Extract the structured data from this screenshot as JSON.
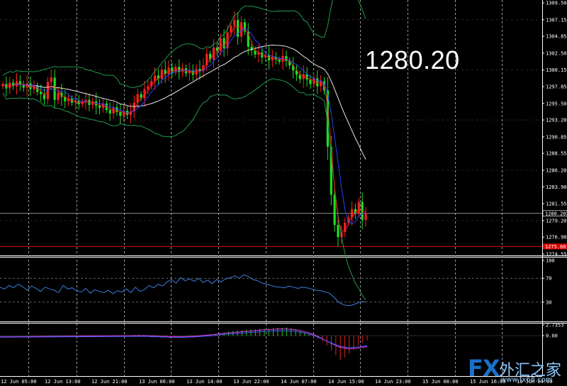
{
  "overlay_price": "1280.20",
  "logo": {
    "fx": "FX",
    "cn": "外汇之家",
    "url": "www.fx68.com"
  },
  "chart_data": [
    {
      "type": "candlestick",
      "panel": "main",
      "ylim": [
        1274.55,
        1309.5
      ],
      "y_ticks": [
        "1309.50",
        "1307.15",
        "1304.85",
        "1302.50",
        "1300.15",
        "1297.85",
        "1295.50",
        "1293.20",
        "1290.85",
        "1288.55",
        "1286.20",
        "1283.90",
        "1281.55",
        "1280.20",
        "1279.20",
        "1276.90",
        "1275.60",
        "1274.55"
      ],
      "current_price": 1280.2,
      "red_line_price": 1275.6,
      "x_labels": [
        "12 Jun 05:00",
        "12 Jun 13:00",
        "12 Jun 21:00",
        "13 Jun 06:00",
        "13 Jun 14:00",
        "13 Jun 22:00",
        "14 Jun 07:00",
        "14 Jun 15:00",
        "14 Jun 23:00",
        "15 Jun 08:00",
        "15 Jun 16:00",
        "18 Jun 04:00"
      ],
      "closes": [
        1298.2,
        1297.6,
        1298.4,
        1297.9,
        1298.6,
        1298.1,
        1297.7,
        1298.3,
        1297.5,
        1298.0,
        1297.1,
        1296.8,
        1296.1,
        1298.5,
        1299.1,
        1296.0,
        1297.0,
        1296.4,
        1295.8,
        1296.2,
        1295.6,
        1295.9,
        1295.4,
        1295.7,
        1296.0,
        1295.3,
        1295.8,
        1295.2,
        1294.9,
        1295.5,
        1294.6,
        1294.1,
        1295.0,
        1294.3,
        1293.8,
        1294.5,
        1293.9,
        1294.4,
        1295.6,
        1296.8,
        1296.2,
        1297.5,
        1297.9,
        1298.6,
        1299.4,
        1298.9,
        1300.2,
        1299.6,
        1300.5,
        1299.8,
        1300.6,
        1299.9,
        1300.4,
        1299.7,
        1300.1,
        1299.5,
        1300.3,
        1300.0,
        1300.8,
        1302.4,
        1301.6,
        1303.3,
        1302.8,
        1304.6,
        1303.2,
        1305.4,
        1306.3,
        1307.1,
        1304.8,
        1306.8,
        1305.5,
        1303.4,
        1302.9,
        1302.3,
        1302.6,
        1301.9,
        1302.2,
        1301.5,
        1302.0,
        1301.6,
        1301.3,
        1302.1,
        1301.4,
        1300.8,
        1300.1,
        1299.5,
        1298.9,
        1299.6,
        1298.8,
        1298.2,
        1299.0,
        1297.9,
        1298.6,
        1297.3,
        1289.5,
        1282.8,
        1278.6,
        1276.9,
        1277.6,
        1278.9,
        1279.6,
        1280.8,
        1280.2,
        1281.8,
        1279.3,
        1280.2
      ],
      "indicators": [
        "ma_white",
        "ma_blue",
        "ma_red",
        "bollinger_upper",
        "bollinger_lower"
      ]
    },
    {
      "type": "line",
      "panel": "rsi",
      "ylim": [
        0,
        100
      ],
      "y_ticks": [
        100,
        70,
        30,
        0
      ],
      "series": [
        {
          "values": [
            55,
            52,
            58,
            54,
            60,
            56,
            50,
            57,
            53,
            48,
            55,
            52,
            50,
            46,
            58,
            52,
            54,
            49,
            47,
            53,
            45,
            51,
            48,
            46,
            50,
            44,
            49,
            47,
            52,
            46,
            55,
            48,
            51,
            58,
            54,
            60,
            57,
            64,
            68,
            62,
            71,
            66,
            69,
            65,
            70,
            63,
            67,
            61,
            68,
            64,
            69,
            71,
            74,
            70,
            76,
            73,
            68,
            66,
            62,
            60,
            58,
            56,
            55,
            54,
            57,
            55,
            53,
            55,
            54,
            52,
            50,
            49,
            47,
            45,
            38,
            30,
            26,
            24,
            25,
            28,
            31,
            30
          ]
        }
      ]
    },
    {
      "type": "macd",
      "panel": "macd",
      "y_ticks": [
        "2.7353",
        "0.00"
      ],
      "histogram": [
        0.2,
        0.3,
        0.2,
        0.1,
        0.1,
        0.0,
        -0.1,
        -0.2,
        -0.3,
        -0.3,
        -0.4,
        -0.5,
        -0.4,
        -0.3,
        -0.2,
        -0.1,
        0.0,
        0.2,
        0.4,
        0.6,
        0.8,
        1.0,
        1.2,
        1.3,
        1.4,
        1.5,
        1.6,
        1.6,
        1.7,
        1.7,
        1.8,
        1.9,
        2.0,
        2.0,
        2.1,
        1.9,
        1.6,
        1.2,
        0.8,
        0.4,
        -0.2,
        -0.8,
        -1.6,
        -2.6,
        -3.8,
        -5.0,
        -6.2,
        -5.6,
        -4.6,
        -3.6,
        -2.6,
        -1.8,
        -1.2
      ],
      "signal": [
        0.0,
        0.0,
        0.0,
        0.0,
        -0.1,
        -0.1,
        -0.2,
        -0.2,
        -0.3,
        -0.3,
        -0.3,
        -0.3,
        -0.2,
        -0.2,
        -0.1,
        0.0,
        0.1,
        0.2,
        0.3,
        0.5,
        0.6,
        0.7,
        0.8,
        0.9,
        1.0,
        1.1,
        1.2,
        1.3,
        1.4,
        1.5,
        1.6,
        1.6,
        1.7,
        1.7,
        1.7,
        1.6,
        1.5,
        1.3,
        1.0,
        0.7,
        0.3,
        -0.2,
        -0.8,
        -1.4,
        -2.0,
        -2.5,
        -3.0,
        -3.2,
        -3.4,
        -3.3,
        -3.2,
        -3.0,
        -2.8
      ]
    }
  ]
}
